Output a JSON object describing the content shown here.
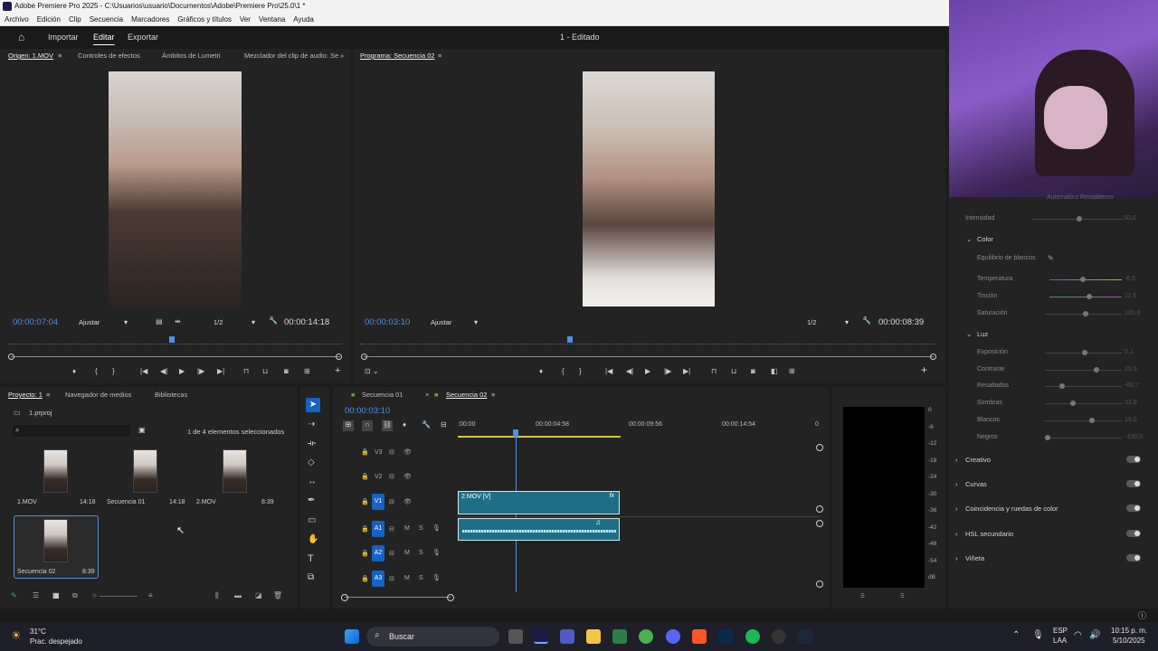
{
  "window": {
    "title": "Adobe Premiere Pro 2025 - C:\\Usuarios\\usuario\\Documentos\\Adobe\\Premiere Pro\\25.0\\1 *"
  },
  "menu": [
    "Archivo",
    "Edición",
    "Clip",
    "Secuencia",
    "Marcadores",
    "Gráficos y títulos",
    "Ver",
    "Ventana",
    "Ayuda"
  ],
  "header": {
    "import": "Importar",
    "edit": "Editar",
    "export": "Exportar",
    "project_title": "1 - Editado"
  },
  "source": {
    "tabs": [
      "Origen: 1.MOV",
      "Controles de efectos",
      "Ámbitos de Lumetri",
      "Mezclador del clip de audio: Se"
    ],
    "timecode": "00:00:07:04",
    "fit": "Ajustar",
    "res": "1/2",
    "duration": "00:00:14:18"
  },
  "program": {
    "tab": "Programa: Secuencia 02",
    "timecode": "00:00:03:10",
    "fit": "Ajustar",
    "res": "1/2",
    "duration": "00:00:08:39"
  },
  "project": {
    "tabs": [
      "Proyecto: 1",
      "Navegador de medios",
      "Bibliotecas"
    ],
    "file": "1.prproj",
    "selection": "1 de 4 elementos seleccionados",
    "items": [
      {
        "name": "1.MOV",
        "dur": "14:18"
      },
      {
        "name": "Secuencia 01",
        "dur": "14:18"
      },
      {
        "name": "2.MOV",
        "dur": "8:39"
      },
      {
        "name": "Secuencia 02",
        "dur": "8:39"
      }
    ]
  },
  "timeline": {
    "tabs": [
      "Secuencia 01",
      "Secuencia 02"
    ],
    "timecode": "00:00:03:10",
    "ruler": [
      ":00:00",
      "00:00:04:58",
      "00:00:09:56",
      "00:00:14:54"
    ],
    "tracks_v": [
      "V3",
      "V2",
      "V1"
    ],
    "tracks_a": [
      "A1",
      "A2",
      "A3"
    ],
    "clip": "2.MOV [V]",
    "m": "M",
    "s": "S",
    "fx": "fx"
  },
  "meter": {
    "scale": [
      "0",
      "-6",
      "-12",
      "-18",
      "-24",
      "-30",
      "-36",
      "-42",
      "-48",
      "-54",
      "dB"
    ],
    "s": "S"
  },
  "lumetri": {
    "partial_top": "Automático     Restablecer",
    "intensity": "Intensidad",
    "intensity_val": "50,0",
    "color_h": "Color",
    "wb": "Equilibrio de blancos",
    "color": [
      {
        "l": "Temperatura",
        "v": "-6,6"
      },
      {
        "l": "Tinción",
        "v": "11,5"
      },
      {
        "l": "Saturación",
        "v": "100,0"
      }
    ],
    "luz_h": "Luz",
    "luz": [
      {
        "l": "Exposición",
        "v": "0,1"
      },
      {
        "l": "Contraste",
        "v": "29,5"
      },
      {
        "l": "Resaltados",
        "v": "-60,7"
      },
      {
        "l": "Sombras",
        "v": "32,8"
      },
      {
        "l": "Blancos",
        "v": "19,0"
      },
      {
        "l": "Negros",
        "v": "-100,0"
      }
    ],
    "sections": [
      "Creativo",
      "Curvas",
      "Coincidencia y ruedas de color",
      "HSL secundario",
      "Viñeta"
    ]
  },
  "taskbar": {
    "temp": "31°C",
    "weather": "Prac. despejado",
    "search": "Buscar",
    "lang1": "ESP",
    "lang2": "LAA",
    "time": "10:15 p. m.",
    "date": "5/10/2025"
  }
}
